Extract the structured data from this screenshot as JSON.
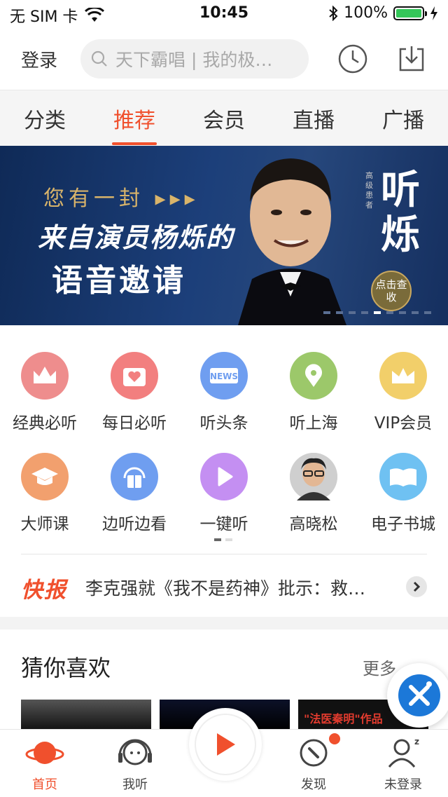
{
  "status_bar": {
    "carrier": "无 SIM 卡",
    "time": "10:45",
    "battery": "100%"
  },
  "header": {
    "login_label": "登录",
    "search_placeholder": "天下霸唱 | 我的极…"
  },
  "tabs": [
    {
      "label": "分类"
    },
    {
      "label": "推荐"
    },
    {
      "label": "会员"
    },
    {
      "label": "直播"
    },
    {
      "label": "广播"
    }
  ],
  "banner": {
    "line1": "您有一封 ▸▸▸",
    "line2": "来自演员杨烁的",
    "line3": "语音邀请",
    "vertical_title": "听烁",
    "vertical_small": "高级患者",
    "cta": "点击查收"
  },
  "quick_grid": [
    {
      "label": "经典必听",
      "icon": "crown-icon",
      "color": "#ee8d8d"
    },
    {
      "label": "每日必听",
      "icon": "calendar-heart-icon",
      "color": "#f27f7f"
    },
    {
      "label": "听头条",
      "icon": "news-icon",
      "color": "#6f9ef0"
    },
    {
      "label": "听上海",
      "icon": "location-pin-icon",
      "color": "#9cc86a"
    },
    {
      "label": "VIP会员",
      "icon": "vip-crown-icon",
      "color": "#f2cf6a"
    },
    {
      "label": "大师课",
      "icon": "graduation-cap-icon",
      "color": "#f2a06e"
    },
    {
      "label": "边听边看",
      "icon": "headphone-book-icon",
      "color": "#6f9ef0"
    },
    {
      "label": "一键听",
      "icon": "play-icon",
      "color": "#c48ff2"
    },
    {
      "label": "高晓松",
      "icon": "avatar-icon",
      "color": "#dddddd"
    },
    {
      "label": "电子书城",
      "icon": "open-book-icon",
      "color": "#6fc1f2"
    }
  ],
  "flash": {
    "tag": "快报",
    "text": "李克强就《我不是药神》批示：救…"
  },
  "guess": {
    "title": "猜你喜欢",
    "more": "更多"
  },
  "thumb_caption": "\"法医秦明\"作品",
  "tabbar": [
    {
      "label": "首页"
    },
    {
      "label": "我听"
    },
    {
      "label": "发现"
    },
    {
      "label": "未登录"
    }
  ],
  "colors": {
    "accent": "#f0502d"
  }
}
